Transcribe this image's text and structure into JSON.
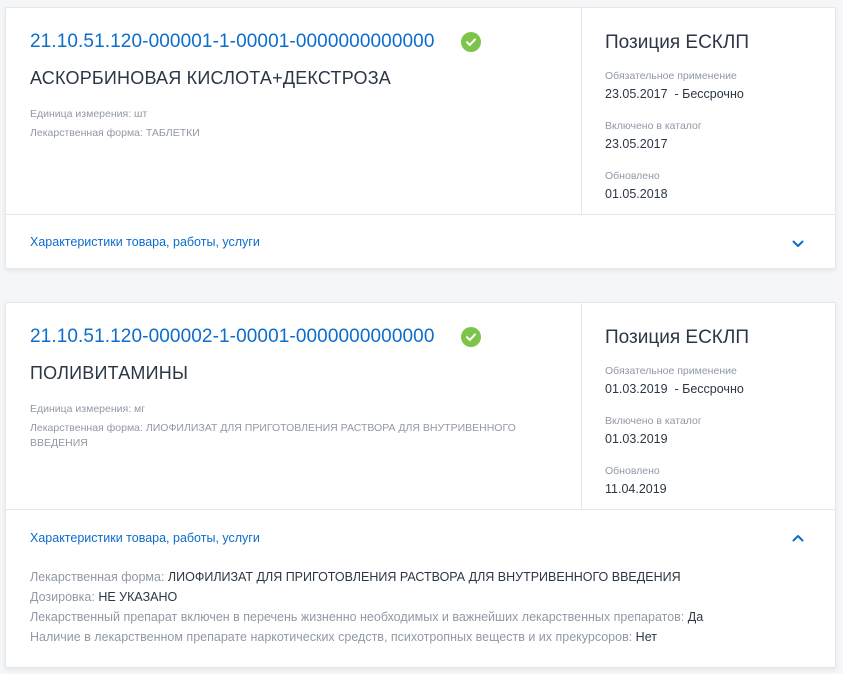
{
  "cards": [
    {
      "code": "21.10.51.120-000001-1-00001-0000000000000",
      "name": "АСКОРБИНОВАЯ КИСЛОТА+ДЕКСТРОЗА",
      "unit": "Единица измерения: шт",
      "form": "Лекарственная форма: ТАБЛЕТКИ",
      "position_title": "Позиция ЕСКЛП",
      "mandatory_label": "Обязательное применение",
      "mandatory_value": "23.05.2017  - Бессрочно",
      "included_label": "Включено в каталог",
      "included_value": "23.05.2017",
      "updated_label": "Обновлено",
      "updated_value": "01.05.2018",
      "characteristics_label": "Характеристики товара, работы, услуги"
    },
    {
      "code": "21.10.51.120-000002-1-00001-0000000000000",
      "name": "ПОЛИВИТАМИНЫ",
      "unit": "Единица измерения: мг",
      "form": "Лекарственная форма: ЛИОФИЛИЗАТ ДЛЯ ПРИГОТОВЛЕНИЯ РАСТВОРА ДЛЯ ВНУТРИВЕННОГО ВВЕДЕНИЯ",
      "position_title": "Позиция ЕСКЛП",
      "mandatory_label": "Обязательное применение",
      "mandatory_value": "01.03.2019  - Бессрочно",
      "included_label": "Включено в каталог",
      "included_value": "01.03.2019",
      "updated_label": "Обновлено",
      "updated_value": "11.04.2019",
      "characteristics_label": "Характеристики товара, работы, услуги",
      "characteristics": [
        {
          "key": "Лекарственная форма:",
          "value": "ЛИОФИЛИЗАТ ДЛЯ ПРИГОТОВЛЕНИЯ РАСТВОРА ДЛЯ ВНУТРИВЕННОГО ВВЕДЕНИЯ"
        },
        {
          "key": "Дозировка:",
          "value": "НЕ УКАЗАНО"
        },
        {
          "key": "Лекарственный препарат включен в перечень жизненно необходимых и важнейших лекарственных препаратов:",
          "value": "Да"
        },
        {
          "key": "Наличие в лекарственном препарате наркотических средств, психотропных веществ и их прекурсоров:",
          "value": "Нет"
        }
      ]
    }
  ],
  "icons": {
    "verified": "check-circle-icon",
    "expand": "chevron-down-icon",
    "collapse": "chevron-up-icon"
  },
  "colors": {
    "link": "#0d6dcb",
    "verified": "#7dc44a"
  }
}
